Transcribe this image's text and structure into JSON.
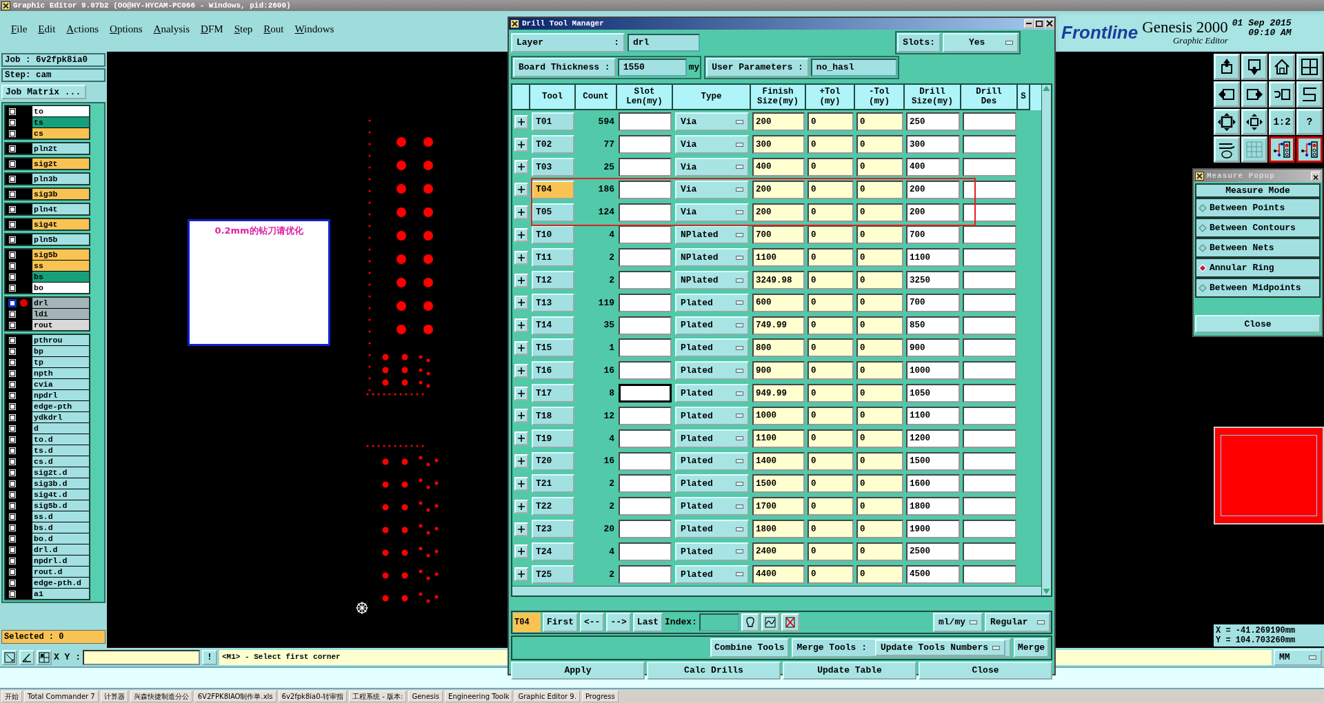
{
  "window": {
    "title": "Graphic Editor 9.07b2 (OO@HY-HYCAM-PC066 - Windows, pid:2600)"
  },
  "menu": [
    "File",
    "Edit",
    "Actions",
    "Options",
    "Analysis",
    "DFM",
    "Step",
    "Rout",
    "Windows"
  ],
  "brand": {
    "logo": "Frontline",
    "product": "Genesis 2000",
    "subtitle": "Graphic Editor",
    "date": "01 Sep 2015",
    "time": "09:10 AM"
  },
  "job": {
    "job": "Job : 6v2fpk8ia0",
    "step": "Step: cam",
    "matrix_button": "Job Matrix ...",
    "selected_count": "Selected : 0"
  },
  "layer_groups": [
    {
      "layers": [
        {
          "name": "to",
          "color": "#ffffff",
          "active": false
        },
        {
          "name": "ts",
          "color": "#17a07c",
          "active": false
        },
        {
          "name": "cs",
          "color": "#f9c353",
          "active": false
        }
      ]
    },
    {
      "layers": [
        {
          "name": "pln2t",
          "color": "#a2e0e2",
          "active": false
        }
      ]
    },
    {
      "layers": [
        {
          "name": "sig2t",
          "color": "#f9c353",
          "active": false
        }
      ]
    },
    {
      "layers": [
        {
          "name": "pln3b",
          "color": "#a2e0e2",
          "active": false
        }
      ]
    },
    {
      "layers": [
        {
          "name": "sig3b",
          "color": "#f9c353",
          "active": false
        }
      ]
    },
    {
      "layers": [
        {
          "name": "pln4t",
          "color": "#a2e0e2",
          "active": false
        }
      ]
    },
    {
      "layers": [
        {
          "name": "sig4t",
          "color": "#f9c353",
          "active": false
        }
      ]
    },
    {
      "layers": [
        {
          "name": "pln5b",
          "color": "#a2e0e2",
          "active": false
        }
      ]
    },
    {
      "layers": [
        {
          "name": "sig5b",
          "color": "#f9c353",
          "active": false
        },
        {
          "name": "ss",
          "color": "#f9c353",
          "active": false
        },
        {
          "name": "bs",
          "color": "#17a07c",
          "active": false
        },
        {
          "name": "bo",
          "color": "#ffffff",
          "active": false
        }
      ]
    },
    {
      "layers": [
        {
          "name": "drl",
          "color": "#a3b5b9",
          "active": true
        },
        {
          "name": "ldi",
          "color": "#a3b5b9",
          "active": false
        },
        {
          "name": "rout",
          "color": "#d9d9d9",
          "active": false
        }
      ]
    },
    {
      "layers": [
        {
          "name": "pthrou",
          "color": "#a2e0e2",
          "active": false
        },
        {
          "name": "bp",
          "color": "#a2e0e2",
          "active": false
        },
        {
          "name": "tp",
          "color": "#a2e0e2",
          "active": false
        },
        {
          "name": "npth",
          "color": "#a2e0e2",
          "active": false
        },
        {
          "name": "cvia",
          "color": "#a2e0e2",
          "active": false
        },
        {
          "name": "npdrl",
          "color": "#a2e0e2",
          "active": false
        },
        {
          "name": "edge-pth",
          "color": "#a2e0e2",
          "active": false
        },
        {
          "name": "ydkdrl",
          "color": "#a2e0e2",
          "active": false
        },
        {
          "name": "d",
          "color": "#a2e0e2",
          "active": false
        },
        {
          "name": "to.d",
          "color": "#a2e0e2",
          "active": false
        },
        {
          "name": "ts.d",
          "color": "#a2e0e2",
          "active": false
        },
        {
          "name": "cs.d",
          "color": "#a2e0e2",
          "active": false
        },
        {
          "name": "sig2t.d",
          "color": "#a2e0e2",
          "active": false
        },
        {
          "name": "sig3b.d",
          "color": "#a2e0e2",
          "active": false
        },
        {
          "name": "sig4t.d",
          "color": "#a2e0e2",
          "active": false
        },
        {
          "name": "sig5b.d",
          "color": "#a2e0e2",
          "active": false
        },
        {
          "name": "ss.d",
          "color": "#a2e0e2",
          "active": false
        },
        {
          "name": "bs.d",
          "color": "#a2e0e2",
          "active": false
        },
        {
          "name": "bo.d",
          "color": "#a2e0e2",
          "active": false
        },
        {
          "name": "drl.d",
          "color": "#a2e0e2",
          "active": false
        },
        {
          "name": "npdrl.d",
          "color": "#a2e0e2",
          "active": false
        },
        {
          "name": "rout.d",
          "color": "#a2e0e2",
          "active": false
        },
        {
          "name": "edge-pth.d",
          "color": "#a2e0e2",
          "active": false
        },
        {
          "name": "a1",
          "color": "#a2e0e2",
          "active": false
        }
      ]
    }
  ],
  "canvas": {
    "note": "0.2mm的钻刀请优化"
  },
  "toolbar": [
    {
      "kind": "up",
      "highlighted": false
    },
    {
      "kind": "down",
      "highlighted": false
    },
    {
      "kind": "home",
      "highlighted": false
    },
    {
      "kind": "window",
      "highlighted": false
    },
    {
      "kind": "left",
      "highlighted": false
    },
    {
      "kind": "right",
      "highlighted": false
    },
    {
      "kind": "undo",
      "highlighted": false
    },
    {
      "kind": "snake",
      "highlighted": false
    },
    {
      "kind": "fit",
      "highlighted": false
    },
    {
      "kind": "center",
      "highlighted": false
    },
    {
      "kind": "label",
      "label": "1:2",
      "highlighted": false
    },
    {
      "kind": "label",
      "label": "?",
      "highlighted": false
    },
    {
      "kind": "tools",
      "highlighted": false
    },
    {
      "kind": "grid",
      "highlighted": false
    },
    {
      "kind": "circuit",
      "highlighted": true
    },
    {
      "kind": "circuit",
      "highlighted": true
    }
  ],
  "coordinates": {
    "x": "X = -41.269190mm",
    "y": "Y = 104.703260mm"
  },
  "command_bar": {
    "xy_label": "X Y :",
    "bang": "!",
    "prompt": "<M1> - Select first corner",
    "units": "MM"
  },
  "drill_manager": {
    "title": "Drill Tool Manager",
    "layer_label": "Layer",
    "colon": ":",
    "layer": "drl",
    "slots_label": "Slots:",
    "slots": "Yes",
    "thickness_label": "Board Thickness :",
    "thickness": "1550",
    "thickness_unit": "my",
    "params_label": "User Parameters :",
    "params": "no_hasl",
    "columns": [
      "Tool",
      "Count",
      "Slot\nLen(my)",
      "Type",
      "Finish\nSize(my)",
      "+Tol\n(my)",
      "-Tol\n(my)",
      "Drill\nSize(my)",
      "Drill\nDes",
      "S"
    ],
    "rows": [
      {
        "tool": "T01",
        "count": "594",
        "type": "Via",
        "finish": "200",
        "plus_tol": "0",
        "minus_tol": "0",
        "drill_size": "250",
        "selected": false,
        "marked": false,
        "focused": false
      },
      {
        "tool": "T02",
        "count": "77",
        "type": "Via",
        "finish": "300",
        "plus_tol": "0",
        "minus_tol": "0",
        "drill_size": "300",
        "selected": false,
        "marked": false,
        "focused": false
      },
      {
        "tool": "T03",
        "count": "25",
        "type": "Via",
        "finish": "400",
        "plus_tol": "0",
        "minus_tol": "0",
        "drill_size": "400",
        "selected": false,
        "marked": false,
        "focused": false
      },
      {
        "tool": "T04",
        "count": "186",
        "type": "Via",
        "finish": "200",
        "plus_tol": "0",
        "minus_tol": "0",
        "drill_size": "200",
        "selected": true,
        "marked": true,
        "focused": false
      },
      {
        "tool": "T05",
        "count": "124",
        "type": "Via",
        "finish": "200",
        "plus_tol": "0",
        "minus_tol": "0",
        "drill_size": "200",
        "selected": false,
        "marked": true,
        "focused": false
      },
      {
        "tool": "T10",
        "count": "4",
        "type": "NPlated",
        "finish": "700",
        "plus_tol": "0",
        "minus_tol": "0",
        "drill_size": "700",
        "selected": false,
        "marked": false,
        "focused": false
      },
      {
        "tool": "T11",
        "count": "2",
        "type": "NPlated",
        "finish": "1100",
        "plus_tol": "0",
        "minus_tol": "0",
        "drill_size": "1100",
        "selected": false,
        "marked": false,
        "focused": false
      },
      {
        "tool": "T12",
        "count": "2",
        "type": "NPlated",
        "finish": "3249.98",
        "plus_tol": "0",
        "minus_tol": "0",
        "drill_size": "3250",
        "selected": false,
        "marked": false,
        "focused": false
      },
      {
        "tool": "T13",
        "count": "119",
        "type": "Plated",
        "finish": "600",
        "plus_tol": "0",
        "minus_tol": "0",
        "drill_size": "700",
        "selected": false,
        "marked": false,
        "focused": false
      },
      {
        "tool": "T14",
        "count": "35",
        "type": "Plated",
        "finish": "749.99",
        "plus_tol": "0",
        "minus_tol": "0",
        "drill_size": "850",
        "selected": false,
        "marked": false,
        "focused": false
      },
      {
        "tool": "T15",
        "count": "1",
        "type": "Plated",
        "finish": "800",
        "plus_tol": "0",
        "minus_tol": "0",
        "drill_size": "900",
        "selected": false,
        "marked": false,
        "focused": false
      },
      {
        "tool": "T16",
        "count": "16",
        "type": "Plated",
        "finish": "900",
        "plus_tol": "0",
        "minus_tol": "0",
        "drill_size": "1000",
        "selected": false,
        "marked": false,
        "focused": false
      },
      {
        "tool": "T17",
        "count": "8",
        "type": "Plated",
        "finish": "949.99",
        "plus_tol": "0",
        "minus_tol": "0",
        "drill_size": "1050",
        "selected": false,
        "marked": false,
        "focused": true
      },
      {
        "tool": "T18",
        "count": "12",
        "type": "Plated",
        "finish": "1000",
        "plus_tol": "0",
        "minus_tol": "0",
        "drill_size": "1100",
        "selected": false,
        "marked": false,
        "focused": false
      },
      {
        "tool": "T19",
        "count": "4",
        "type": "Plated",
        "finish": "1100",
        "plus_tol": "0",
        "minus_tol": "0",
        "drill_size": "1200",
        "selected": false,
        "marked": false,
        "focused": false
      },
      {
        "tool": "T20",
        "count": "16",
        "type": "Plated",
        "finish": "1400",
        "plus_tol": "0",
        "minus_tol": "0",
        "drill_size": "1500",
        "selected": false,
        "marked": false,
        "focused": false
      },
      {
        "tool": "T21",
        "count": "2",
        "type": "Plated",
        "finish": "1500",
        "plus_tol": "0",
        "minus_tol": "0",
        "drill_size": "1600",
        "selected": false,
        "marked": false,
        "focused": false
      },
      {
        "tool": "T22",
        "count": "2",
        "type": "Plated",
        "finish": "1700",
        "plus_tol": "0",
        "minus_tol": "0",
        "drill_size": "1800",
        "selected": false,
        "marked": false,
        "focused": false
      },
      {
        "tool": "T23",
        "count": "20",
        "type": "Plated",
        "finish": "1800",
        "plus_tol": "0",
        "minus_tol": "0",
        "drill_size": "1900",
        "selected": false,
        "marked": false,
        "focused": false
      },
      {
        "tool": "T24",
        "count": "4",
        "type": "Plated",
        "finish": "2400",
        "plus_tol": "0",
        "minus_tol": "0",
        "drill_size": "2500",
        "selected": false,
        "marked": false,
        "focused": false
      },
      {
        "tool": "T25",
        "count": "2",
        "type": "Plated",
        "finish": "4400",
        "plus_tol": "0",
        "minus_tol": "0",
        "drill_size": "4500",
        "selected": false,
        "marked": false,
        "focused": false
      }
    ],
    "current_tool": "T04",
    "nav": [
      "First",
      "<--",
      "-->",
      "Last"
    ],
    "index_label": "Index:",
    "units": "ml/my",
    "mode": "Regular",
    "combine": "Combine Tools",
    "merge_label": "Merge Tools :",
    "merge_mode": "Update Tools Numbers",
    "merge": "Merge",
    "actions": [
      "Apply",
      "Calc Drills",
      "Update Table",
      "Close"
    ]
  },
  "measure_popup": {
    "title": "Measure Popup",
    "header": "Measure Mode",
    "options": [
      {
        "label": "Between Points",
        "selected": false
      },
      {
        "label": "Between Contours",
        "selected": false
      },
      {
        "label": "Between Nets",
        "selected": false
      },
      {
        "label": "Annular Ring",
        "selected": true
      },
      {
        "label": "Between Midpoints",
        "selected": false
      }
    ],
    "close": "Close"
  },
  "taskbar": [
    "开始",
    "Total Commander 7",
    "计算器",
    "兴森快捷制造分公",
    "6V2FPK8IAO制作单.xls",
    "6v2fpk8ia0-转审指",
    "工程系统 - 版本:",
    "Genesis",
    "Engineering Toolk",
    "Graphic Editor 9.",
    "Progress"
  ]
}
